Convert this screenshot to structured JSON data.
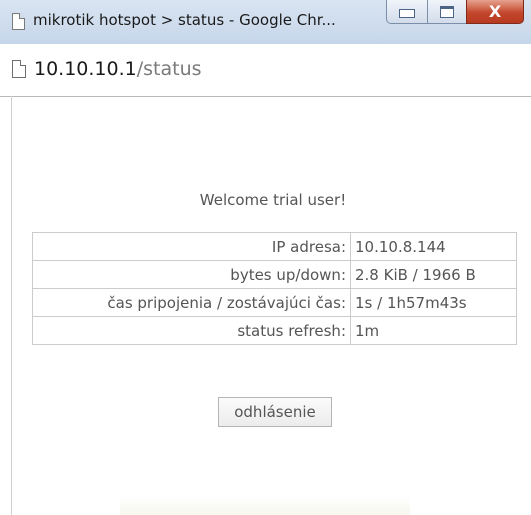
{
  "window": {
    "title": "mikrotik hotspot > status - Google Chr...",
    "minimize_symbol": "",
    "maximize_symbol": "",
    "close_symbol": "X"
  },
  "address": {
    "host": "10.10.10.1",
    "path": "/status"
  },
  "content": {
    "welcome": "Welcome trial user!",
    "rows": [
      {
        "label": "IP adresa:",
        "value": "10.10.8.144"
      },
      {
        "label": "bytes up/down:",
        "value": "2.8 KiB / 1966 B"
      },
      {
        "label": "čas pripojenia / zostávajúci čas:",
        "value": "1s / 1h57m43s"
      },
      {
        "label": "status refresh:",
        "value": "1m"
      }
    ],
    "logout_label": "odhlásenie"
  },
  "icons": {
    "tab_icon": "page-icon",
    "address_icon": "page-icon"
  },
  "colors": {
    "close_button": "#c3472c",
    "titlebar": "#d0dcea",
    "text": "#555555"
  }
}
